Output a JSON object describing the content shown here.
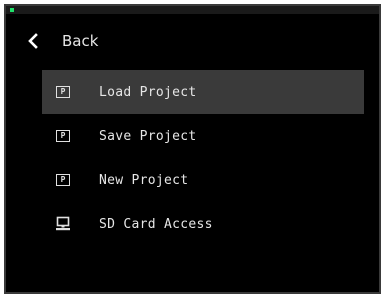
{
  "status": {
    "indicator_color": "#1fe06a"
  },
  "nav": {
    "back_label": "Back",
    "back_icon": "chevron-left-icon"
  },
  "menu": {
    "items": [
      {
        "label": "Load Project",
        "icon": "project-icon",
        "icon_letter": "P",
        "selected": true
      },
      {
        "label": "Save Project",
        "icon": "project-icon",
        "icon_letter": "P",
        "selected": false
      },
      {
        "label": "New Project",
        "icon": "project-icon",
        "icon_letter": "P",
        "selected": false
      },
      {
        "label": "SD Card Access",
        "icon": "computer-icon",
        "selected": false
      }
    ]
  },
  "colors": {
    "background": "#000000",
    "selected_row": "#3a3a3a",
    "text": "#e6e6e6"
  }
}
